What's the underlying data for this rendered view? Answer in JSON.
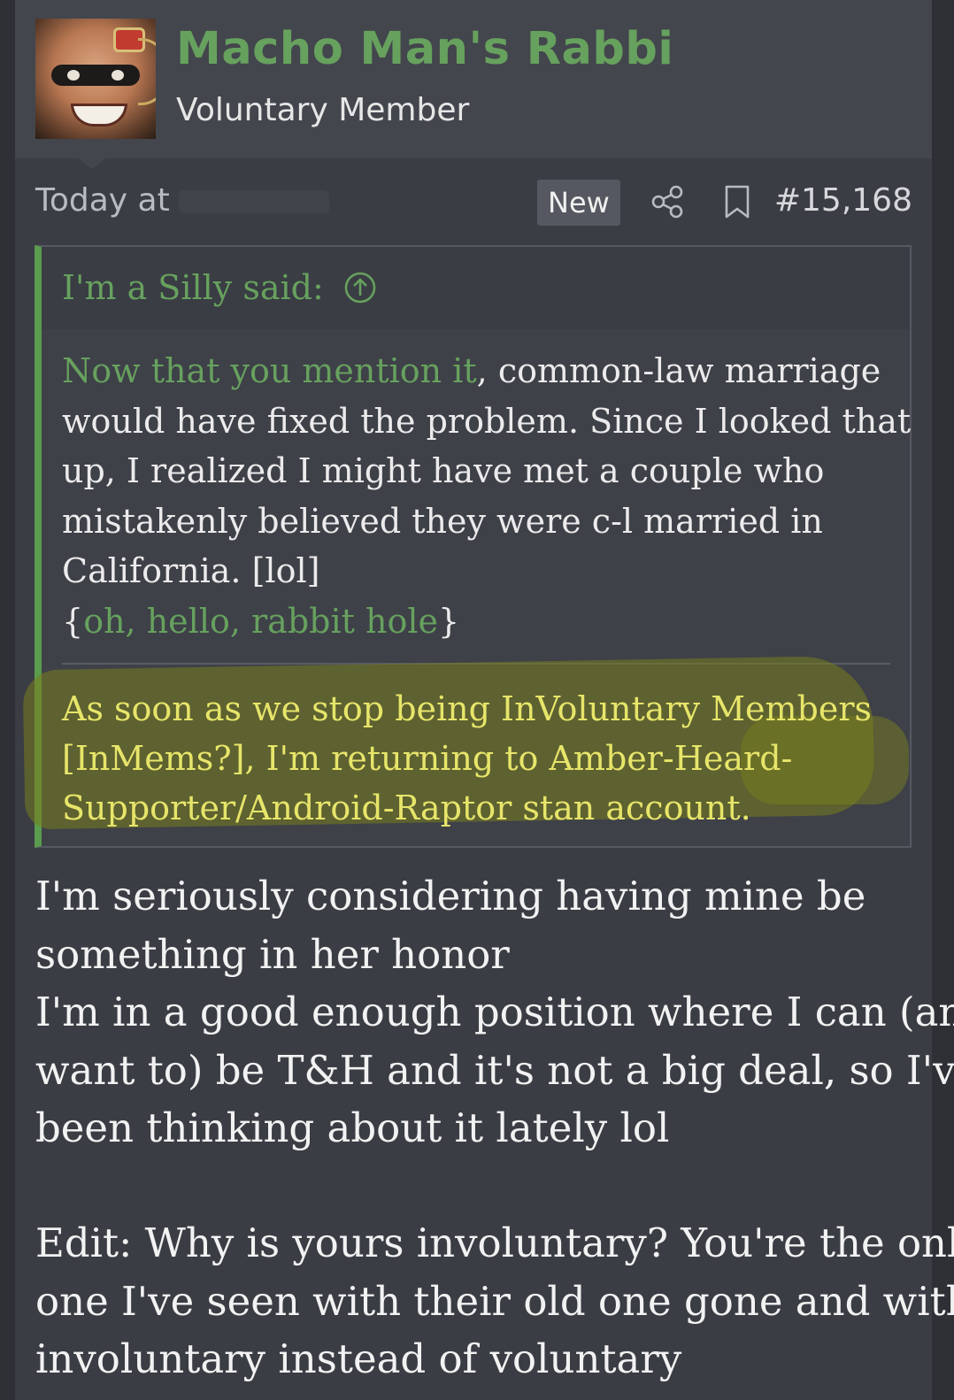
{
  "user": {
    "name": "Macho Man's Rabbi",
    "title": "Voluntary Member",
    "avatar_icon": "avatar-face-icon"
  },
  "post": {
    "time_prefix": "Today at",
    "new_badge": "New",
    "post_number": "#15,168",
    "icons": [
      "share-icon",
      "bookmark-icon"
    ]
  },
  "quote": {
    "attribution": "I'm a Silly said:",
    "link_icon": "up-arrow-circle-icon",
    "lines": [
      {
        "green": "Now that you mention it",
        "rest": ", common-law marriage"
      },
      {
        "green": "",
        "rest": "would have fixed the problem. Since I looked that"
      },
      {
        "green": "",
        "rest": "up, I realized I might have met a couple who"
      },
      {
        "green": "",
        "rest": "mistakenly believed they were c-l married in"
      },
      {
        "green": "",
        "rest": "California. [lol]"
      }
    ],
    "brace_open": "{",
    "brace_text": "oh, hello, rabbit hole",
    "brace_close": "}",
    "highlight_lines": [
      "As soon as we stop being InVoluntary Members",
      "[InMems?], I'm returning to Amber-Heard-",
      "Supporter/Android-Raptor stan account."
    ]
  },
  "body": {
    "lines": [
      "I'm seriously considering having mine be",
      "something in her honor",
      "I'm in a good enough position where I can (and",
      "want to) be T&H and it's not a big deal, so I've",
      "been thinking about it lately lol"
    ],
    "edit_lines": [
      "Edit: Why is yours involuntary? You're the only",
      "one I've seen with their old one gone and with",
      "involuntary instead of voluntary"
    ]
  },
  "colors": {
    "accent_green": "#67a15e",
    "highlight_yellow": "#e7e56a",
    "background": "#3a3d44"
  }
}
